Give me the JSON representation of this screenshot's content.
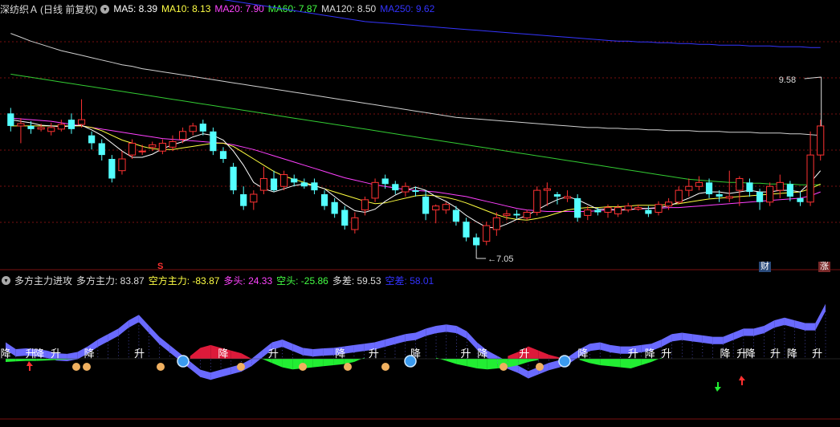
{
  "top_header": {
    "stock_name": "深纺织Ａ",
    "period": "(日线 前复权)",
    "ma": [
      {
        "label": "MA5:",
        "value": "8.39",
        "color": "#ffffff"
      },
      {
        "label": "MA10:",
        "value": "8.13",
        "color": "#ffff44"
      },
      {
        "label": "MA20:",
        "value": "7.90",
        "color": "#ff44ff"
      },
      {
        "label": "MA60:",
        "value": "7.87",
        "color": "#44ff44"
      },
      {
        "label": "MA120:",
        "value": "8.50",
        "color": "#dddddd"
      },
      {
        "label": "MA250:",
        "value": "9.62",
        "color": "#3333ff"
      }
    ]
  },
  "bottom_header": {
    "indicator": "多方主力进攻",
    "items": [
      {
        "label": "多方主力:",
        "value": "83.87",
        "color": "#dddddd"
      },
      {
        "label": "空方主力:",
        "value": "-83.87",
        "color": "#ffff44"
      },
      {
        "label": "多头:",
        "value": "24.33",
        "color": "#ff44ff"
      },
      {
        "label": "空头:",
        "value": "-25.86",
        "color": "#44ff44"
      },
      {
        "label": "多差:",
        "value": "59.53",
        "color": "#dddddd"
      },
      {
        "label": "空差:",
        "value": "58.01",
        "color": "#3333ff"
      }
    ]
  },
  "badges": {
    "cai": "财",
    "zhang": "涨",
    "s": "S"
  },
  "chart_data": {
    "type": "candlestick",
    "price_range": [
      6.85,
      10.0
    ],
    "high_label": "9.58",
    "low_label": "7.05",
    "candles": [
      [
        8.78,
        8.62,
        8.85,
        8.55
      ],
      [
        8.62,
        8.65,
        8.72,
        8.4
      ],
      [
        8.62,
        8.58,
        8.68,
        8.52
      ],
      [
        8.58,
        8.6,
        8.65,
        8.55
      ],
      [
        8.55,
        8.6,
        8.66,
        8.5
      ],
      [
        8.58,
        8.64,
        8.7,
        8.55
      ],
      [
        8.7,
        8.58,
        8.78,
        8.52
      ],
      [
        8.64,
        8.7,
        8.96,
        8.6
      ],
      [
        8.5,
        8.4,
        8.55,
        8.32
      ],
      [
        8.4,
        8.25,
        8.45,
        8.18
      ],
      [
        8.2,
        7.95,
        8.25,
        7.9
      ],
      [
        8.05,
        8.2,
        8.3,
        8.0
      ],
      [
        8.25,
        8.4,
        8.45,
        8.2
      ],
      [
        8.3,
        8.3,
        8.38,
        8.25
      ],
      [
        8.35,
        8.38,
        8.42,
        8.3
      ],
      [
        8.3,
        8.4,
        8.45,
        8.26
      ],
      [
        8.35,
        8.42,
        8.5,
        8.3
      ],
      [
        8.45,
        8.55,
        8.6,
        8.4
      ],
      [
        8.55,
        8.62,
        8.66,
        8.5
      ],
      [
        8.65,
        8.55,
        8.7,
        8.5
      ],
      [
        8.55,
        8.3,
        8.6,
        8.25
      ],
      [
        8.3,
        8.2,
        8.35,
        8.15
      ],
      [
        8.1,
        7.8,
        8.15,
        7.75
      ],
      [
        7.75,
        7.6,
        7.85,
        7.55
      ],
      [
        7.65,
        7.75,
        7.8,
        7.55
      ],
      [
        7.8,
        7.95,
        8.1,
        7.75
      ],
      [
        7.95,
        7.8,
        8.05,
        7.78
      ],
      [
        7.85,
        8.0,
        8.05,
        7.8
      ],
      [
        7.95,
        7.9,
        8.0,
        7.85
      ],
      [
        7.9,
        7.85,
        7.95,
        7.82
      ],
      [
        7.9,
        7.8,
        7.95,
        7.75
      ],
      [
        7.75,
        7.6,
        7.8,
        7.55
      ],
      [
        7.65,
        7.5,
        7.7,
        7.45
      ],
      [
        7.55,
        7.35,
        7.6,
        7.3
      ],
      [
        7.3,
        7.45,
        7.52,
        7.25
      ],
      [
        7.55,
        7.68,
        7.72,
        7.48
      ],
      [
        7.7,
        7.9,
        7.95,
        7.65
      ],
      [
        7.95,
        7.88,
        8.0,
        7.82
      ],
      [
        7.88,
        7.8,
        7.92,
        7.75
      ],
      [
        7.78,
        7.85,
        7.9,
        7.72
      ],
      [
        7.8,
        7.78,
        7.85,
        7.72
      ],
      [
        7.72,
        7.5,
        7.8,
        7.42
      ],
      [
        7.55,
        7.6,
        7.62,
        7.38
      ],
      [
        7.55,
        7.62,
        7.65,
        7.5
      ],
      [
        7.55,
        7.4,
        7.6,
        7.35
      ],
      [
        7.4,
        7.2,
        7.45,
        7.15
      ],
      [
        7.2,
        7.1,
        7.25,
        7.05
      ],
      [
        7.15,
        7.35,
        7.4,
        7.1
      ],
      [
        7.3,
        7.45,
        7.52,
        7.22
      ],
      [
        7.48,
        7.5,
        7.55,
        7.42
      ],
      [
        7.5,
        7.48,
        7.55,
        7.44
      ],
      [
        7.45,
        7.52,
        7.55,
        7.42
      ],
      [
        7.52,
        7.8,
        7.85,
        7.48
      ],
      [
        7.8,
        7.82,
        7.9,
        7.6
      ],
      [
        7.75,
        7.72,
        7.78,
        7.62
      ],
      [
        7.7,
        7.72,
        7.8,
        7.65
      ],
      [
        7.7,
        7.45,
        7.75,
        7.4
      ],
      [
        7.48,
        7.55,
        7.6,
        7.42
      ],
      [
        7.55,
        7.52,
        7.58,
        7.48
      ],
      [
        7.52,
        7.58,
        7.62,
        7.45
      ],
      [
        7.5,
        7.58,
        7.62,
        7.46
      ],
      [
        7.55,
        7.6,
        7.64,
        7.52
      ],
      [
        7.56,
        7.58,
        7.62,
        7.54
      ],
      [
        7.55,
        7.5,
        7.6,
        7.46
      ],
      [
        7.52,
        7.62,
        7.66,
        7.48
      ],
      [
        7.6,
        7.65,
        7.7,
        7.55
      ],
      [
        7.65,
        7.8,
        7.85,
        7.62
      ],
      [
        7.8,
        7.85,
        7.95,
        7.72
      ],
      [
        7.85,
        7.9,
        7.98,
        7.8
      ],
      [
        7.9,
        7.75,
        7.95,
        7.7
      ],
      [
        7.75,
        7.72,
        7.8,
        7.65
      ],
      [
        7.7,
        7.72,
        8.05,
        7.65
      ],
      [
        7.8,
        7.95,
        7.98,
        7.6
      ],
      [
        7.9,
        7.78,
        7.95,
        7.72
      ],
      [
        7.78,
        7.65,
        7.82,
        7.55
      ],
      [
        7.65,
        7.85,
        7.9,
        7.6
      ],
      [
        7.8,
        7.9,
        8.0,
        7.7
      ],
      [
        7.88,
        7.72,
        7.92,
        7.66
      ],
      [
        7.7,
        7.65,
        7.78,
        7.6
      ],
      [
        7.65,
        8.25,
        8.55,
        7.6
      ],
      [
        8.25,
        8.62,
        8.7,
        8.18
      ]
    ],
    "ma5": [
      8.7,
      8.68,
      8.66,
      8.63,
      8.62,
      8.61,
      8.62,
      8.63,
      8.57,
      8.5,
      8.4,
      8.3,
      8.22,
      8.22,
      8.26,
      8.33,
      8.38,
      8.42,
      8.48,
      8.52,
      8.5,
      8.44,
      8.3,
      8.12,
      7.9,
      7.82,
      7.78,
      7.82,
      7.86,
      7.88,
      7.86,
      7.82,
      7.72,
      7.62,
      7.54,
      7.52,
      7.56,
      7.66,
      7.74,
      7.8,
      7.84,
      7.8,
      7.72,
      7.66,
      7.58,
      7.48,
      7.4,
      7.33,
      7.32,
      7.37,
      7.43,
      7.48,
      7.55,
      7.62,
      7.68,
      7.72,
      7.68,
      7.62,
      7.56,
      7.56,
      7.55,
      7.55,
      7.57,
      7.57,
      7.58,
      7.6,
      7.65,
      7.7,
      7.76,
      7.78,
      7.78,
      7.76,
      7.78,
      7.8,
      7.78,
      7.78,
      7.8,
      7.8,
      7.78,
      7.9,
      8.05
    ],
    "ma10": [
      8.62,
      8.62,
      8.62,
      8.62,
      8.62,
      8.62,
      8.62,
      8.62,
      8.6,
      8.56,
      8.5,
      8.44,
      8.4,
      8.36,
      8.33,
      8.32,
      8.32,
      8.34,
      8.36,
      8.38,
      8.4,
      8.4,
      8.36,
      8.28,
      8.2,
      8.12,
      8.04,
      7.98,
      7.94,
      7.9,
      7.86,
      7.82,
      7.78,
      7.74,
      7.7,
      7.66,
      7.63,
      7.64,
      7.67,
      7.7,
      7.73,
      7.74,
      7.73,
      7.71,
      7.68,
      7.64,
      7.59,
      7.54,
      7.49,
      7.45,
      7.43,
      7.42,
      7.44,
      7.47,
      7.51,
      7.55,
      7.57,
      7.58,
      7.58,
      7.59,
      7.59,
      7.6,
      7.61,
      7.61,
      7.61,
      7.62,
      7.63,
      7.65,
      7.67,
      7.69,
      7.7,
      7.71,
      7.72,
      7.73,
      7.74,
      7.75,
      7.76,
      7.77,
      7.78,
      7.82,
      7.88
    ],
    "ma20": [
      8.72,
      8.71,
      8.7,
      8.69,
      8.68,
      8.66,
      8.64,
      8.62,
      8.6,
      8.58,
      8.56,
      8.54,
      8.52,
      8.5,
      8.48,
      8.46,
      8.45,
      8.44,
      8.43,
      8.42,
      8.41,
      8.4,
      8.38,
      8.35,
      8.32,
      8.28,
      8.24,
      8.2,
      8.16,
      8.12,
      8.08,
      8.04,
      8.0,
      7.96,
      7.93,
      7.9,
      7.87,
      7.85,
      7.83,
      7.81,
      7.8,
      7.79,
      7.78,
      7.76,
      7.74,
      7.72,
      7.69,
      7.66,
      7.63,
      7.6,
      7.57,
      7.55,
      7.54,
      7.53,
      7.53,
      7.53,
      7.53,
      7.53,
      7.54,
      7.55,
      7.55,
      7.56,
      7.56,
      7.57,
      7.57,
      7.58,
      7.58,
      7.59,
      7.6,
      7.61,
      7.62,
      7.63,
      7.64,
      7.65,
      7.66,
      7.67,
      7.68,
      7.69,
      7.7,
      7.73,
      7.78
    ],
    "ma60": [
      9.28,
      9.26,
      9.24,
      9.22,
      9.2,
      9.18,
      9.16,
      9.14,
      9.12,
      9.1,
      9.08,
      9.06,
      9.04,
      9.02,
      9.0,
      8.98,
      8.96,
      8.94,
      8.92,
      8.9,
      8.88,
      8.86,
      8.84,
      8.82,
      8.8,
      8.78,
      8.76,
      8.74,
      8.72,
      8.7,
      8.68,
      8.66,
      8.64,
      8.62,
      8.6,
      8.58,
      8.56,
      8.54,
      8.52,
      8.5,
      8.48,
      8.46,
      8.44,
      8.42,
      8.4,
      8.38,
      8.36,
      8.34,
      8.32,
      8.3,
      8.28,
      8.26,
      8.24,
      8.22,
      8.2,
      8.18,
      8.16,
      8.14,
      8.12,
      8.1,
      8.08,
      8.06,
      8.04,
      8.02,
      8.0,
      7.98,
      7.96,
      7.94,
      7.93,
      7.92,
      7.91,
      7.9,
      7.9,
      7.89,
      7.89,
      7.88,
      7.88,
      7.88,
      7.87,
      7.87,
      7.87
    ],
    "ma120": [
      9.8,
      9.75,
      9.7,
      9.66,
      9.62,
      9.58,
      9.55,
      9.52,
      9.49,
      9.46,
      9.43,
      9.4,
      9.38,
      9.35,
      9.33,
      9.31,
      9.29,
      9.27,
      9.25,
      9.23,
      9.21,
      9.19,
      9.17,
      9.15,
      9.13,
      9.11,
      9.09,
      9.07,
      9.05,
      9.03,
      9.01,
      8.99,
      8.97,
      8.95,
      8.93,
      8.91,
      8.89,
      8.87,
      8.85,
      8.83,
      8.81,
      8.79,
      8.77,
      8.75,
      8.73,
      8.72,
      8.71,
      8.7,
      8.69,
      8.68,
      8.67,
      8.66,
      8.65,
      8.64,
      8.63,
      8.62,
      8.61,
      8.6,
      8.6,
      8.59,
      8.59,
      8.58,
      8.58,
      8.57,
      8.57,
      8.56,
      8.56,
      8.56,
      8.55,
      8.55,
      8.55,
      8.54,
      8.54,
      8.54,
      8.53,
      8.53,
      8.53,
      8.52,
      8.52,
      8.51,
      8.5
    ],
    "ma250": [
      10.65,
      10.63,
      10.61,
      10.59,
      10.57,
      10.55,
      10.53,
      10.51,
      10.49,
      10.47,
      10.45,
      10.43,
      10.41,
      10.39,
      10.37,
      10.35,
      10.33,
      10.31,
      10.29,
      10.27,
      10.25,
      10.23,
      10.21,
      10.19,
      10.17,
      10.15,
      10.13,
      10.11,
      10.09,
      10.07,
      10.05,
      10.03,
      10.01,
      9.99,
      9.97,
      9.95,
      9.94,
      9.93,
      9.92,
      9.91,
      9.9,
      9.89,
      9.88,
      9.87,
      9.86,
      9.85,
      9.84,
      9.83,
      9.82,
      9.81,
      9.8,
      9.79,
      9.78,
      9.77,
      9.76,
      9.75,
      9.74,
      9.73,
      9.72,
      9.71,
      9.7,
      9.7,
      9.69,
      9.69,
      9.68,
      9.68,
      9.67,
      9.67,
      9.66,
      9.66,
      9.65,
      9.65,
      9.65,
      9.64,
      9.64,
      9.64,
      9.63,
      9.63,
      9.63,
      9.62,
      9.62
    ],
    "indicator": {
      "value_range": [
        -100,
        100
      ],
      "upper_zero": [
        60,
        35,
        38,
        35,
        30,
        20,
        18,
        25,
        45,
        70,
        90,
        110,
        140,
        160,
        120,
        80,
        50,
        20,
        -10,
        -40,
        -50,
        -40,
        -30,
        -20,
        0,
        30,
        60,
        70,
        55,
        40,
        35,
        38,
        40,
        45,
        50,
        55,
        60,
        70,
        80,
        90,
        95,
        110,
        120,
        125,
        120,
        100,
        60,
        30,
        10,
        -10,
        -25,
        -45,
        -30,
        -15,
        -5,
        10,
        35,
        55,
        60,
        50,
        45,
        45,
        50,
        55,
        70,
        90,
        95,
        90,
        85,
        80,
        80,
        95,
        110,
        110,
        120,
        140,
        150,
        140,
        130,
        130,
        200
      ],
      "lower_zero": [
        15,
        12,
        10,
        10,
        8,
        5,
        3,
        0,
        -5,
        -10,
        -20,
        -30,
        -35,
        -25,
        -15,
        -5,
        0,
        -10,
        -25,
        -35,
        -50,
        -60,
        -55,
        -40,
        -15,
        0,
        20,
        40,
        50,
        45,
        40,
        35,
        30,
        25,
        15,
        -5,
        -20,
        -35,
        -45,
        -40,
        -30,
        -15,
        -5,
        10,
        25,
        35,
        45,
        50,
        45,
        40,
        30,
        15,
        5,
        -5,
        -15,
        -10,
        5,
        20,
        30,
        35,
        40,
        45,
        30,
        15,
        -5,
        -30,
        -45,
        -60,
        -70,
        -70,
        -65,
        -60,
        -55,
        -50,
        -45,
        -40,
        -30,
        -30,
        -40,
        -80,
        -140
      ]
    },
    "signals": [
      {
        "i": 0,
        "t": "降"
      },
      {
        "i": 3,
        "t": "升"
      },
      {
        "i": 4,
        "t": "降"
      },
      {
        "i": 6,
        "t": "升"
      },
      {
        "i": 10,
        "t": "降"
      },
      {
        "i": 16,
        "t": "升"
      },
      {
        "i": 26,
        "t": "降"
      },
      {
        "i": 32,
        "t": "升"
      },
      {
        "i": 40,
        "t": "降"
      },
      {
        "i": 44,
        "t": "升"
      },
      {
        "i": 49,
        "t": "降"
      },
      {
        "i": 55,
        "t": "升"
      },
      {
        "i": 57,
        "t": "降"
      },
      {
        "i": 62,
        "t": "升"
      },
      {
        "i": 69,
        "t": "降"
      },
      {
        "i": 75,
        "t": "升"
      },
      {
        "i": 77,
        "t": "降"
      },
      {
        "i": 79,
        "t": "升"
      },
      {
        "i": 86,
        "t": "降"
      },
      {
        "i": 88,
        "t": "升"
      },
      {
        "i": 89,
        "t": "降"
      },
      {
        "i": 92,
        "t": "升"
      },
      {
        "i": 94,
        "t": "降"
      },
      {
        "i": 97,
        "t": "升"
      }
    ]
  }
}
